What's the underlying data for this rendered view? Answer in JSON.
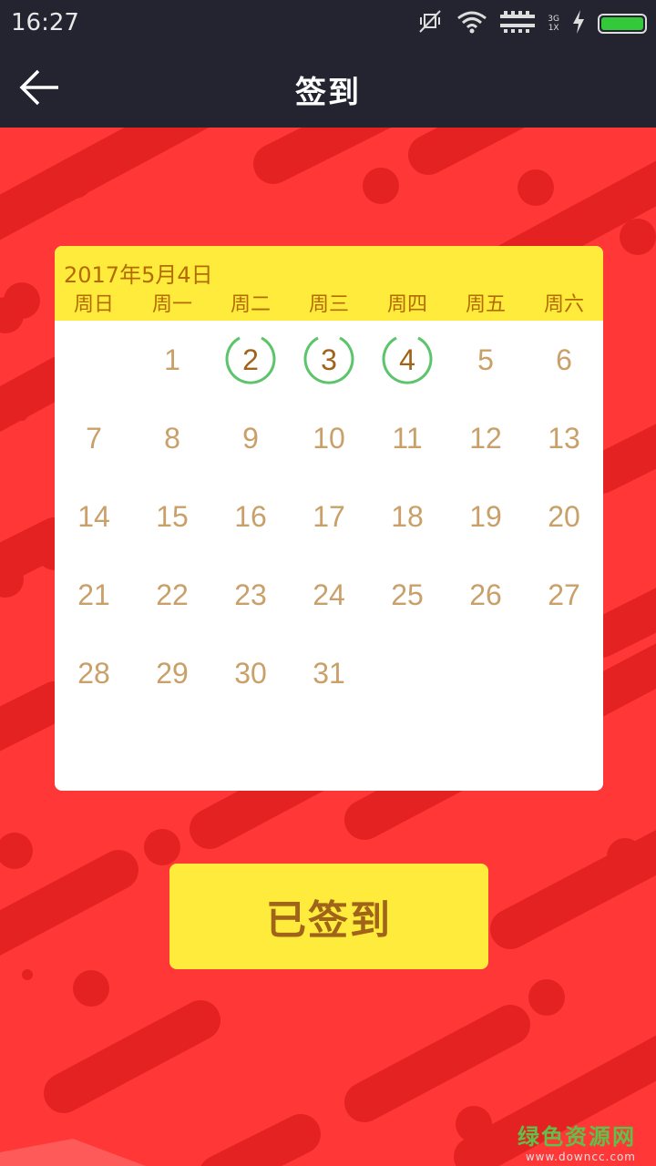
{
  "status_bar": {
    "time": "16:27",
    "network_top": "3G",
    "network_bottom": "1X",
    "icons": [
      "mute-vibrate-icon",
      "wifi-icon",
      "signal-icon",
      "signal-icon",
      "charging-icon",
      "battery-icon"
    ]
  },
  "title_bar": {
    "back_icon": "arrow-left-icon",
    "title": "签到"
  },
  "calendar": {
    "date_label": "2017年5月4日",
    "weekdays": [
      "周日",
      "周一",
      "周二",
      "周三",
      "周四",
      "周五",
      "周六"
    ],
    "leading_blanks": 1,
    "days": [
      "1",
      "2",
      "3",
      "4",
      "5",
      "6",
      "7",
      "8",
      "9",
      "10",
      "11",
      "12",
      "13",
      "14",
      "15",
      "16",
      "17",
      "18",
      "19",
      "20",
      "21",
      "22",
      "23",
      "24",
      "25",
      "26",
      "27",
      "28",
      "29",
      "30",
      "31"
    ],
    "signed_days": [
      "2",
      "3",
      "4"
    ]
  },
  "sign_button": {
    "label": "已签到"
  },
  "watermark": {
    "main": "绿色资源网",
    "sub": "www.downcc.com"
  },
  "colors": {
    "background": "#ff3737",
    "bar": "#232430",
    "accent_yellow": "#ffeb3b",
    "text_brown": "#b36b00",
    "day_text": "#c9a06a",
    "ring_green": "#5cc46a"
  }
}
